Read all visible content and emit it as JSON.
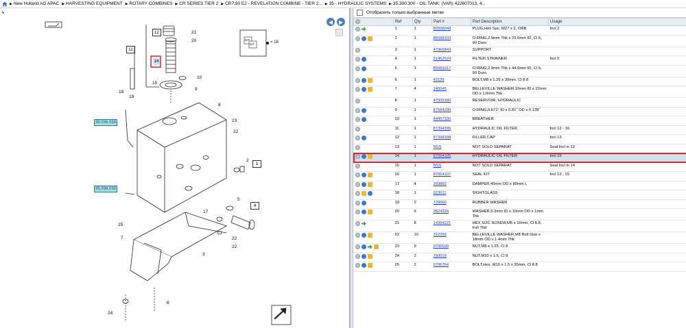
{
  "breadcrumb": [
    "New Holland AG APAC",
    "HARVESTING EQUIPMENT",
    "ROTARY COMBINES",
    "CR SERIES TIER 2",
    "CR7.90 E2 - REVELATION COMBINE - TIER 2...",
    "35 - HYDRAULIC SYSTEMS",
    "35.300.300 - OIL TANK; (VAR) 422607013, 4..."
  ],
  "checkbox_label": "Отобразить только выбранные метки",
  "columns": {
    "ref": "Ref",
    "qty": "Qty",
    "part": "Part #",
    "desc": "Part Description",
    "usage": "Usage"
  },
  "diagram": {
    "callouts": [
      "12",
      "21",
      "20",
      "11",
      "14",
      "10",
      "15",
      "9",
      "18",
      "19",
      "8",
      "23",
      "22",
      "2",
      "1",
      "5",
      "4",
      "17",
      "25",
      "7",
      "3",
      "22",
      "22",
      "6",
      "24"
    ],
    "refs": [
      "35.036.030",
      "35.036.030"
    ],
    "kit_label": "KIT",
    "kit_value": "= 16"
  },
  "colors": {
    "selected_border": "#d9242b",
    "link": "#1b39c7"
  },
  "parts": [
    {
      "icons": [
        "g",
        "gr"
      ],
      "ref": "1",
      "qty": "1",
      "part": "86598048",
      "desc": "PLUG,Hex Soc, M27 x 2, ORB",
      "usage": "Incl 2"
    },
    {
      "icons": [
        "g",
        "b",
        "y"
      ],
      "ref": "2",
      "qty": "1",
      "part": "86598103",
      "desc": "O-RING,2.9mm Thk x 23.6mm ID, Cl 6, 90 Duro",
      "usage": ""
    },
    {
      "icons": [
        "g"
      ],
      "ref": "3",
      "qty": "1",
      "part": "47966843",
      "desc": "SUPPORT",
      "usage": ""
    },
    {
      "icons": [
        "g",
        "b"
      ],
      "ref": "4",
      "qty": "1",
      "part": "51462524",
      "desc": "FILTER STRAINER",
      "usage": "Incl 5"
    },
    {
      "icons": [
        "g",
        "b"
      ],
      "ref": "5",
      "qty": "1",
      "part": "86583917",
      "desc": "O-RING,2.9mm Thk x 44.6mm ID, Cl 6, 90 Duro",
      "usage": ""
    },
    {
      "icons": [
        "g",
        "b",
        "y"
      ],
      "ref": "6",
      "qty": "1",
      "part": "43128",
      "desc": "BOLT,M8 x 1.25 x 30mm, Cl 8.8",
      "usage": ""
    },
    {
      "icons": [
        "g",
        "b",
        "y"
      ],
      "ref": "7",
      "qty": "4",
      "part": "140045",
      "desc": "BELLEVILLE WASHER,10mm ID x 22mm OD x 1.6mm Thk",
      "usage": ""
    },
    {
      "icons": [
        "g"
      ],
      "ref": "8",
      "qty": "1",
      "part": "47939180",
      "desc": "RESERVOIR, HYDRAULIC",
      "usage": ""
    },
    {
      "icons": [
        "g",
        "b"
      ],
      "ref": "9",
      "qty": "1",
      "part": "87584290",
      "desc": "O-RING,0.671\" ID x 0.81\" OD x 0.139\"",
      "usage": ""
    },
    {
      "icons": [
        "g",
        "b"
      ],
      "ref": "10",
      "qty": "1",
      "part": "84457330",
      "desc": "BREATHER",
      "usage": ""
    },
    {
      "icons": [
        "g"
      ],
      "ref": "11",
      "qty": "1",
      "part": "87394395",
      "desc": "HYDRAULIC OIL FILTER",
      "usage": "Incl 12 - 16"
    },
    {
      "icons": [
        "g",
        "b"
      ],
      "ref": "12",
      "qty": "1",
      "part": "87394398",
      "desc": "FILLER CAP",
      "usage": "Incl 13"
    },
    {
      "icons": [
        "g"
      ],
      "ref": "13",
      "qty": "1",
      "part": "NSS",
      "desc": "NOT SOLD SEPARAT",
      "usage": "Seal Incl in 12"
    },
    {
      "icons": [
        "g",
        "b",
        "y"
      ],
      "ref": "14",
      "qty": "1",
      "part": "87054105",
      "desc": "HYDRAULIC OIL FILTER",
      "usage": "Incl 15",
      "selected": true
    },
    {
      "icons": [
        "g"
      ],
      "ref": "15",
      "qty": "1",
      "part": "NSS",
      "desc": "NOT SOLD SEPARAT",
      "usage": "Seal Incl in 14"
    },
    {
      "icons": [
        "g",
        "b",
        "y"
      ],
      "ref": "16",
      "qty": "1",
      "part": "87054107",
      "desc": "SEAL KIT",
      "usage": "Incl 13 , 15"
    },
    {
      "icons": [
        "g",
        "b",
        "y"
      ],
      "ref": "17",
      "qty": "4",
      "part": "393882",
      "desc": "DAMPER,40mm OD x 80mm L",
      "usage": ""
    },
    {
      "icons": [
        "g",
        "y",
        "b"
      ],
      "ref": "18",
      "qty": "1",
      "part": "923011",
      "desc": "SIGHTGLASS",
      "usage": ""
    },
    {
      "icons": [
        "g",
        "b"
      ],
      "ref": "19",
      "qty": "2",
      "part": "720060",
      "desc": "RUBBER WASHER",
      "usage": ""
    },
    {
      "icons": [
        "g",
        "b",
        "y"
      ],
      "ref": "20",
      "qty": "6",
      "part": "9824326",
      "desc": "WASHER,5.3mm ID x 10mm OD x 1mm Thk",
      "usage": ""
    },
    {
      "icons": [
        "g",
        "gr"
      ],
      "ref": "21",
      "qty": "8",
      "part": "14304221",
      "desc": "HEX SOC SCREW,M5 x 16mm, Cl 8.8, Full Thd",
      "usage": ""
    },
    {
      "icons": [
        "g",
        "b",
        "y"
      ],
      "ref": "22",
      "qty": "10",
      "part": "322358",
      "desc": "BELLEVILLE WASHER,M8 Bolt Size x 18mm OD x 1.4mm Thk",
      "usage": ""
    },
    {
      "icons": [
        "g",
        "b",
        "gr",
        "y"
      ],
      "ref": "23",
      "qty": "9",
      "part": "9706690",
      "desc": "NUT,M8 x 1.25, Cl 8",
      "usage": ""
    },
    {
      "icons": [
        "g",
        "b",
        "y"
      ],
      "ref": "24",
      "qty": "2",
      "part": "150016",
      "desc": "NUT,M10 x 1.5, Cl 8",
      "usage": ""
    },
    {
      "icons": [
        "g",
        "b",
        "y"
      ],
      "ref": "25",
      "qty": "2",
      "part": "9706764",
      "desc": "BOLT,Hex, M10 x 1.5 x 35mm, Cl 8.8",
      "usage": ""
    }
  ]
}
